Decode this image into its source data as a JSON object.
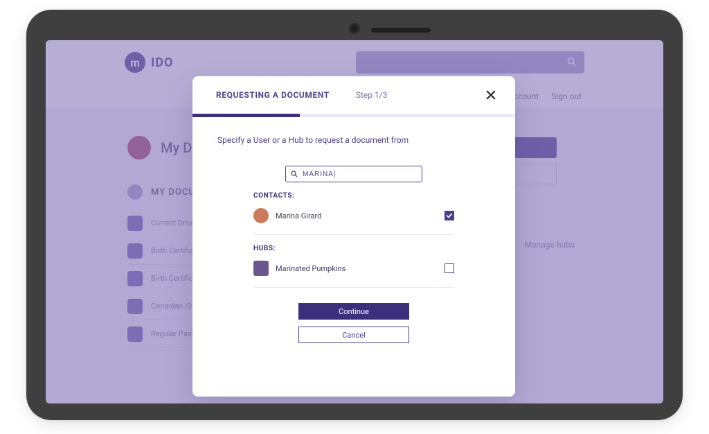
{
  "brand": {
    "badge": "m",
    "name": "IDO"
  },
  "topnav": {
    "account": "Account",
    "signout": "Sign out"
  },
  "dashboard": {
    "title": "My D",
    "section": "MY DOCU",
    "docs": [
      "Current Driver",
      "Birth Certific",
      "Birth Certific",
      "Canadian ID",
      "Regular Passport"
    ],
    "right_link": "Manage hubs"
  },
  "modal": {
    "title": "REQUESTING A DOCUMENT",
    "step_label": "Step 1/3",
    "progress_fraction": 0.333,
    "instruction": "Specify a User or a Hub to request a document from",
    "search_value": "MARINA|",
    "contacts_label": "CONTACTS:",
    "hubs_label": "HUBS:",
    "contacts": [
      {
        "name": "Marina Girard",
        "checked": true
      }
    ],
    "hubs": [
      {
        "name": "Marinated Pumpkins",
        "checked": false
      }
    ],
    "continue_label": "Continue",
    "cancel_label": "Cancel"
  }
}
